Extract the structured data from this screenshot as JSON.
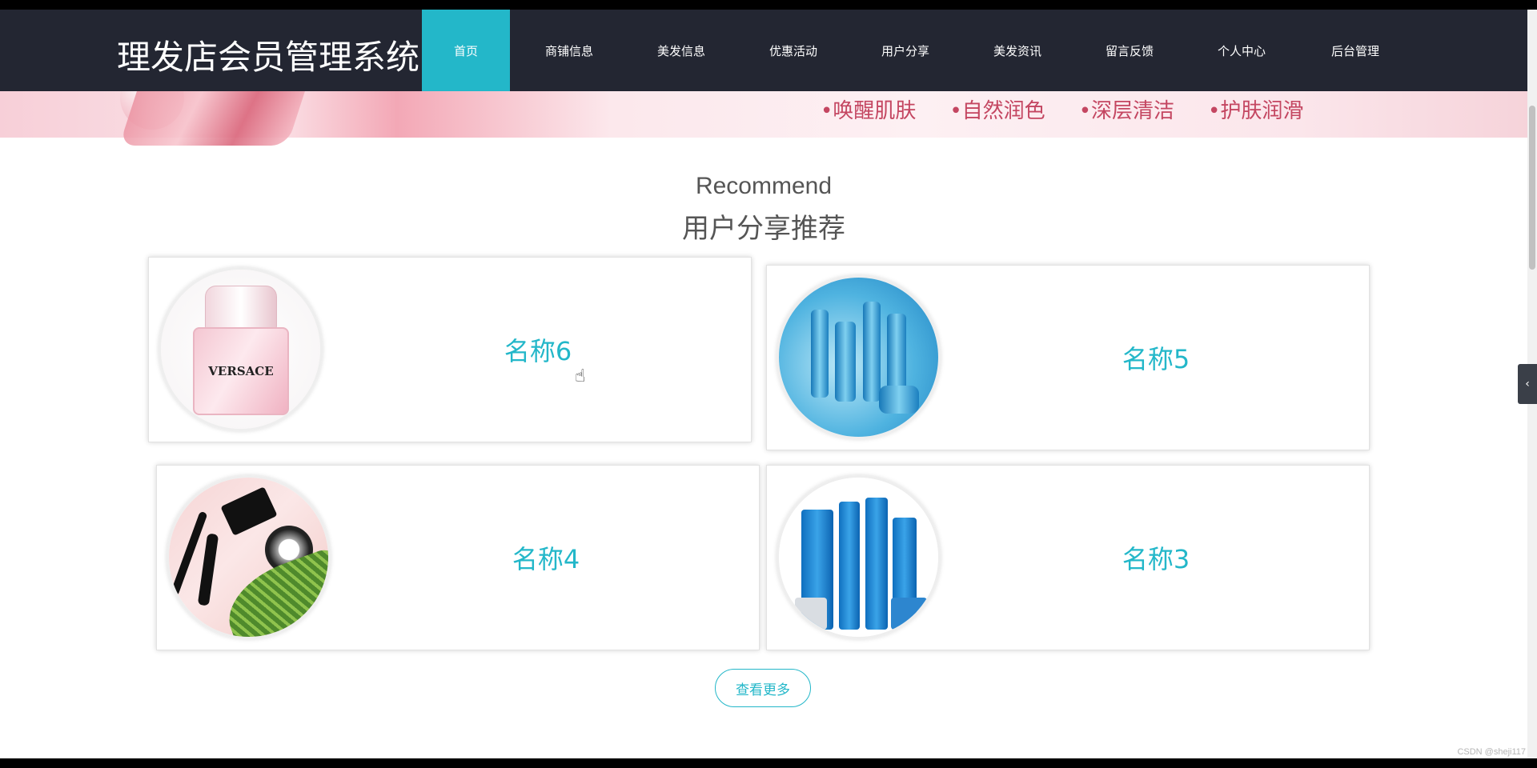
{
  "site": {
    "title": "理发店会员管理系统"
  },
  "nav": {
    "items": [
      {
        "label": "首页",
        "active": true
      },
      {
        "label": "商铺信息"
      },
      {
        "label": "美发信息"
      },
      {
        "label": "优惠活动"
      },
      {
        "label": "用户分享"
      },
      {
        "label": "美发资讯"
      },
      {
        "label": "留言反馈"
      },
      {
        "label": "个人中心"
      },
      {
        "label": "后台管理"
      }
    ]
  },
  "banner": {
    "features": [
      "•唤醒肌肤",
      "•自然润色",
      "•深层清洁",
      "•护肤润滑"
    ]
  },
  "recommend": {
    "title_en": "Recommend",
    "title_cn": "用户分享推荐",
    "cards": [
      {
        "name": "名称6",
        "image": "versace-perfume"
      },
      {
        "name": "名称5",
        "image": "blue-skincare-water"
      },
      {
        "name": "名称4",
        "image": "makeup-brushes-leaf"
      },
      {
        "name": "名称3",
        "image": "wetcode-blue-skincare"
      }
    ],
    "more_label": "查看更多"
  },
  "perfume_label": "VERSACE",
  "side_tab_icon": "‹",
  "watermark": "CSDN @sheji117",
  "colors": {
    "nav_bg": "#232632",
    "accent": "#23b7c9"
  }
}
